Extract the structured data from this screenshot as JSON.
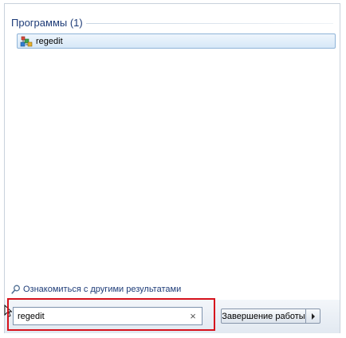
{
  "results": {
    "section_title": "Программы (1)",
    "items": [
      {
        "label": "regedit",
        "icon": "regedit-icon"
      }
    ]
  },
  "more_results": {
    "label": "Ознакомиться с другими результатами",
    "icon": "search-icon"
  },
  "search": {
    "value": "regedit",
    "clear_glyph": "×"
  },
  "shutdown": {
    "label": "Завершение работы",
    "arrow_icon": "arrow-right-icon"
  },
  "colors": {
    "highlight": "#d6121c",
    "link_text": "#1e3c78",
    "selection_border": "#8fb4d8"
  }
}
